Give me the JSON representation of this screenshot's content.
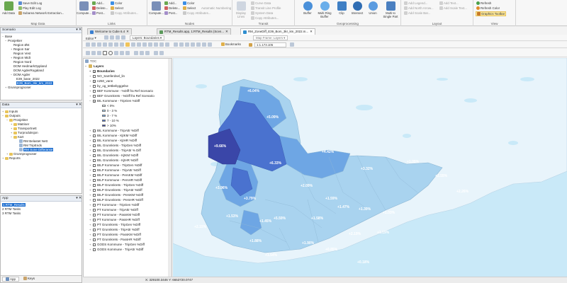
{
  "ribbon": {
    "map_data": {
      "label": "Map Data",
      "save_edit_log": "Save Edit Log",
      "play_edit_log": "Play Edit Log",
      "subarea": "Subarea Network Extraction...",
      "add_data": "Add Data"
    },
    "links": {
      "label": "Links",
      "compute": "Compute...",
      "add": "Add...",
      "color": "Color",
      "delete": "Delete...",
      "select": "Select",
      "post": "Post...",
      "copy_attr": "Copy Attributes..."
    },
    "nodes": {
      "label": "Nodes",
      "compute": "Compute...",
      "add": "Add...",
      "color": "Color",
      "delete": "Delete...",
      "select": "Select",
      "post": "Post...",
      "auto_number": "Automatic Numbering",
      "copy_attr": "Copy Attributes..."
    },
    "transit": {
      "label": "Transit",
      "display_lines": "Display Lines",
      "curve_data": "Curve Data",
      "transit_line": "Transit Line Profile",
      "system_data": "System Data",
      "copy_attr": "Copy Attributes..."
    },
    "geoprocessing": {
      "label": "Geoprocessing",
      "buffer": "Buffer",
      "multi_ring": "Multi Ring Buffer",
      "clip": "Clip",
      "intersect": "Intersect",
      "union": "Union",
      "multi_to_single": "Multi to Single Part"
    },
    "layout": {
      "label": "Layout",
      "add_legend": "Add Legend...",
      "add_north": "Add North Arrow...",
      "add_scale_bar": "Add Scale Bar...",
      "add_text": "Add Text...",
      "add_scale_text": "Add Scale Text..."
    },
    "view": {
      "label": "View",
      "refresh": "Refresh",
      "refresh_color": "Refresh Color",
      "graphics_toolbar": "Graphics Toolbar"
    }
  },
  "scenario_panel": {
    "title": "Scenario",
    "items": [
      "Base",
      "Prosjekter",
      "Region Øst",
      "Region Sør",
      "Region Vest",
      "Region Midt",
      "Region Nord",
      "DOM HedmarkOppland",
      "DOM AgderRogaland",
      "DOM Agder",
      "E39_base_2022",
      "E39_Bom_3kr_km_2022",
      "Grunnprognoser"
    ]
  },
  "data_panel": {
    "title": "Data",
    "items": [
      "Inputs",
      "Outputs",
      "Prosjekter",
      "Matriser",
      "Transportnett",
      "Turproduksjon",
      "Kart",
      "RM Belastet Nett",
      "RM TripEnds",
      "RM Sone Differanse",
      "Grunnprognoser",
      "Reports"
    ]
  },
  "app_panel": {
    "title": "App",
    "items": [
      "1 RTM_Results",
      "2 RTM Tasks",
      "3 RTM Tasks"
    ],
    "tabs": [
      "App",
      "Keys"
    ]
  },
  "doc_tabs": [
    "Welcome to Cube 6.4",
    "RTM_Results.app, 1:RTM_Results (Scen...",
    "RM_ZoneDiff_E39_Bom_3kr_km_2022.m..."
  ],
  "map_toolbar": {
    "editor": "Editor",
    "layers": "Layers: Boundaries",
    "map_frame": "Map Frame: Layers",
    "bookmarks": "Bookmarks",
    "scale": "1:1.173.105"
  },
  "toc": {
    "title": "TOC",
    "root": "Layers",
    "layers": [
      {
        "name": "Boundaries",
        "checked": true
      },
      {
        "name": "NO_Samferdsel_lin",
        "checked": false
      },
      {
        "name": "n250_vann",
        "checked": true
      },
      {
        "name": "by_og_tettbebyggelse",
        "checked": false
      },
      {
        "name": "BEF Kommune - %Diff fra Ref Scenario",
        "checked": false
      },
      {
        "name": "BEF Grunnkrets - %Diff fra Ref Scenario",
        "checked": false
      },
      {
        "name": "BIL Kommune - TripGen %Diff",
        "checked": true
      }
    ],
    "legend": [
      {
        "label": "< 0%",
        "color": "#e8f4fb"
      },
      {
        "label": "0 - 3 %",
        "color": "#a9d3ef"
      },
      {
        "label": "3 - 7 %",
        "color": "#6ea6e4"
      },
      {
        "label": "7 - 10 %",
        "color": "#4a72cf"
      },
      {
        "label": "> 10%",
        "color": "#3a46a8"
      }
    ],
    "more_layers": [
      "BIL Kommune - TripAttr %Diff",
      "BIL Kommune - KjtKM %Diff",
      "BIL Kommune - KjtHR %Diff",
      "BIL Grunnkrets - TripGen %Diff",
      "BIL Grunnkrets - TripAttr % Diff",
      "BIL Grunnkrets - KjtKM %Diff",
      "BIL Grunnkrets - KjtHR %Diff",
      "BILP Kommune - TripGen %Diff",
      "BILP Kommune - TripAttr %Diff",
      "BILP Kommune - PersKM %Diff",
      "BILP Kommune - PersHR %Diff",
      "BILP Grunnkrets - TripGen %Diff",
      "BILP Grunnkrets - TripAttr %Diff",
      "BILP Grunnkrets - PersKM %Diff",
      "BILP Grunnkrets - PersHR %Diff",
      "PT Kommune - TripGen %Diff",
      "PT Kommune - TripAttr %Diff",
      "PT Kommune - PassKM %Diff",
      "PT Kommune - PassHR %Diff",
      "PT Grunnkrets - TripGen %Diff",
      "PT Grunnkrets - TripAttr %Diff",
      "PT Grunnkrets - PassKM %Diff",
      "PT Grunnkrets - PassHR %Diff",
      "GODS Kommune - TripGen %Diff",
      "GODS Kommune - TripAttr %Diff"
    ]
  },
  "map_labels": [
    "+6.04%",
    "+5.09%",
    "+4.42%",
    "+9.66%",
    "+6.33%",
    "+3.32%",
    "+1.05%",
    "+2.55%",
    "+2.26%",
    "+2.09%",
    "+3.96%",
    "+3.79%",
    "+1.59%",
    "+1.47%",
    "+1.39%",
    "+1.03%",
    "+5.59%",
    "+1.45%",
    "+1.53%",
    "+1.58%",
    "+2.15%",
    "+1.19%",
    "+2.19%",
    "+1.88%",
    "+1.90%",
    "+0.85%",
    "+0.18%",
    "+1.54%"
  ],
  "status": {
    "coords": "X: 329100.3446 Y: 6653720.0747"
  },
  "colors": {
    "selection": "#1e6fd0",
    "highlight": "#fde89b",
    "water": "#c9e9f8",
    "land": "#e8f4fb"
  }
}
